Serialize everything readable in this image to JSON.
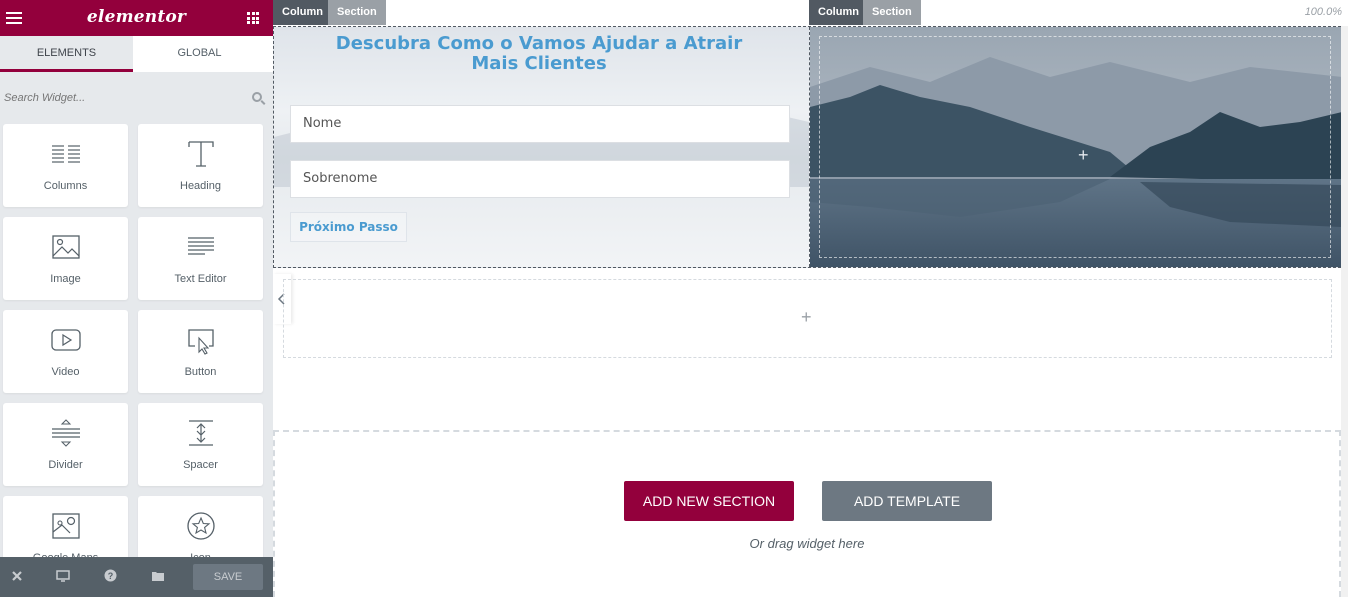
{
  "panel": {
    "logo": "elementor",
    "tabs": [
      {
        "label": "ELEMENTS"
      },
      {
        "label": "GLOBAL"
      }
    ],
    "search": {
      "placeholder": "Search Widget..."
    },
    "widgets": [
      {
        "label": "Columns",
        "icon": "columns-icon"
      },
      {
        "label": "Heading",
        "icon": "heading-icon"
      },
      {
        "label": "Image",
        "icon": "image-icon"
      },
      {
        "label": "Text Editor",
        "icon": "text-editor-icon"
      },
      {
        "label": "Video",
        "icon": "video-icon"
      },
      {
        "label": "Button",
        "icon": "button-icon"
      },
      {
        "label": "Divider",
        "icon": "divider-icon"
      },
      {
        "label": "Spacer",
        "icon": "spacer-icon"
      },
      {
        "label": "Google Maps",
        "icon": "google-maps-icon"
      },
      {
        "label": "Icon",
        "icon": "star-icon"
      }
    ],
    "footer": {
      "save_label": "SAVE"
    }
  },
  "canvas": {
    "zoom": "100.0%",
    "handles": {
      "column": "Column",
      "section": "Section"
    },
    "form": {
      "title": "Descubra Como o Vamos Ajudar a Atrair Mais Clientes",
      "fields": [
        {
          "placeholder": "Nome"
        },
        {
          "placeholder": "Sobrenome"
        }
      ],
      "next_label": "Próximo Passo"
    },
    "add_new_label": "ADD NEW SECTION",
    "add_template_label": "ADD TEMPLATE",
    "drag_hint": "Or drag widget here"
  },
  "colors": {
    "brand": "#93003c",
    "accent_blue": "#4a9bd0",
    "dark_gray": "#515962",
    "mid_gray": "#6d7882"
  }
}
